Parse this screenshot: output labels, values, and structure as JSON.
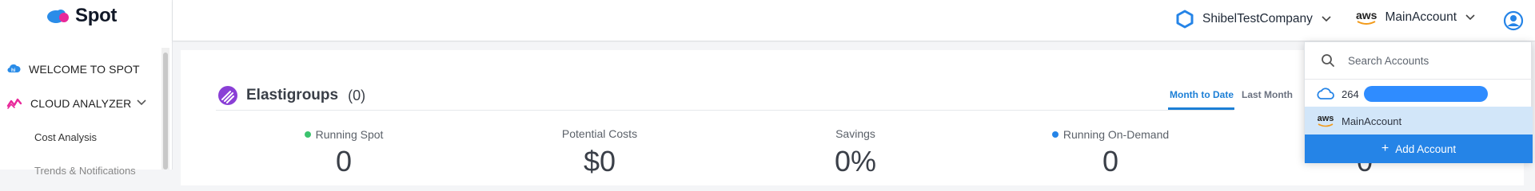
{
  "app": {
    "logo_text": "Spot"
  },
  "sidebar": {
    "items": [
      {
        "label": "WELCOME TO SPOT",
        "icon": "hi-badge-icon"
      },
      {
        "label": "CLOUD ANALYZER",
        "icon": "cloud-analyzer-icon"
      }
    ],
    "subitems": [
      {
        "label": "Cost Analysis"
      },
      {
        "label": "Trends & Notifications"
      }
    ]
  },
  "header": {
    "company": "ShibelTestCompany",
    "account": "MainAccount",
    "aws_badge": "aws"
  },
  "elastigroups": {
    "title": "Elastigroups",
    "count": "(0)",
    "tabs": [
      {
        "label": "Month to Date",
        "active": true
      },
      {
        "label": "Last Month",
        "active": false
      }
    ],
    "metrics": [
      {
        "label": "Running Spot",
        "value": "0",
        "dot_color": "#3cc36e"
      },
      {
        "label": "Potential Costs",
        "value": "$0"
      },
      {
        "label": "Savings",
        "value": "0%"
      },
      {
        "label": "Running On-Demand",
        "value": "0",
        "dot_color": "#2584e7"
      },
      {
        "label": "",
        "value": "0"
      }
    ]
  },
  "account_dropdown": {
    "search_placeholder": "Search Accounts",
    "accounts": [
      {
        "label": "264",
        "icon": "cloud-icon",
        "redacted": true
      },
      {
        "label": "MainAccount",
        "icon": "aws-icon",
        "selected": true,
        "aws_badge": "aws"
      }
    ],
    "add_label": "Add Account",
    "add_symbol": "+"
  },
  "colors": {
    "accent": "#2584e7",
    "selected_row": "#d2e6f9",
    "spot_green": "#3cc36e"
  }
}
